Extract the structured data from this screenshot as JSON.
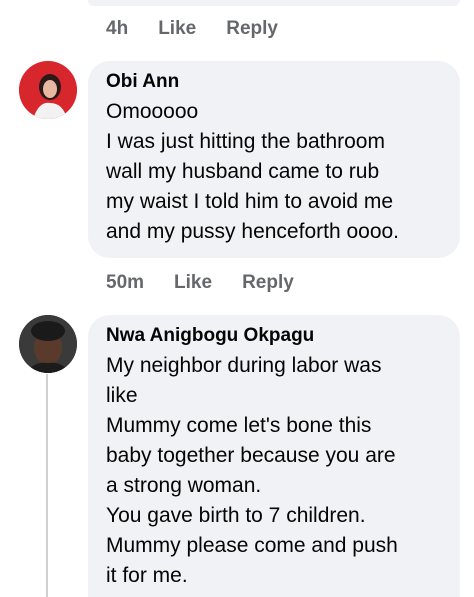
{
  "prev_comment": {
    "time": "4h",
    "like": "Like",
    "reply": "Reply"
  },
  "comment1": {
    "author": "Obi Ann",
    "lines": [
      "Omooooo",
      "I was just hitting the bathroom",
      "wall my husband came to rub",
      "my waist I told him to avoid me",
      "and my pussy henceforth oooo."
    ],
    "time": "50m",
    "like": "Like",
    "reply": "Reply"
  },
  "comment2": {
    "author": "Nwa Anigbogu Okpagu",
    "lines": [
      "My neighbor during labor was",
      "like",
      "Mummy come let's bone this",
      "baby together because you are",
      "a strong woman.",
      "You gave birth to 7 children.",
      "Mummy please come and push",
      "it for me."
    ]
  },
  "colors": {
    "bubble": "#f0f2f5",
    "meta_text": "#65676b",
    "text": "#050505",
    "avatar1_ring": "#e0282f"
  }
}
